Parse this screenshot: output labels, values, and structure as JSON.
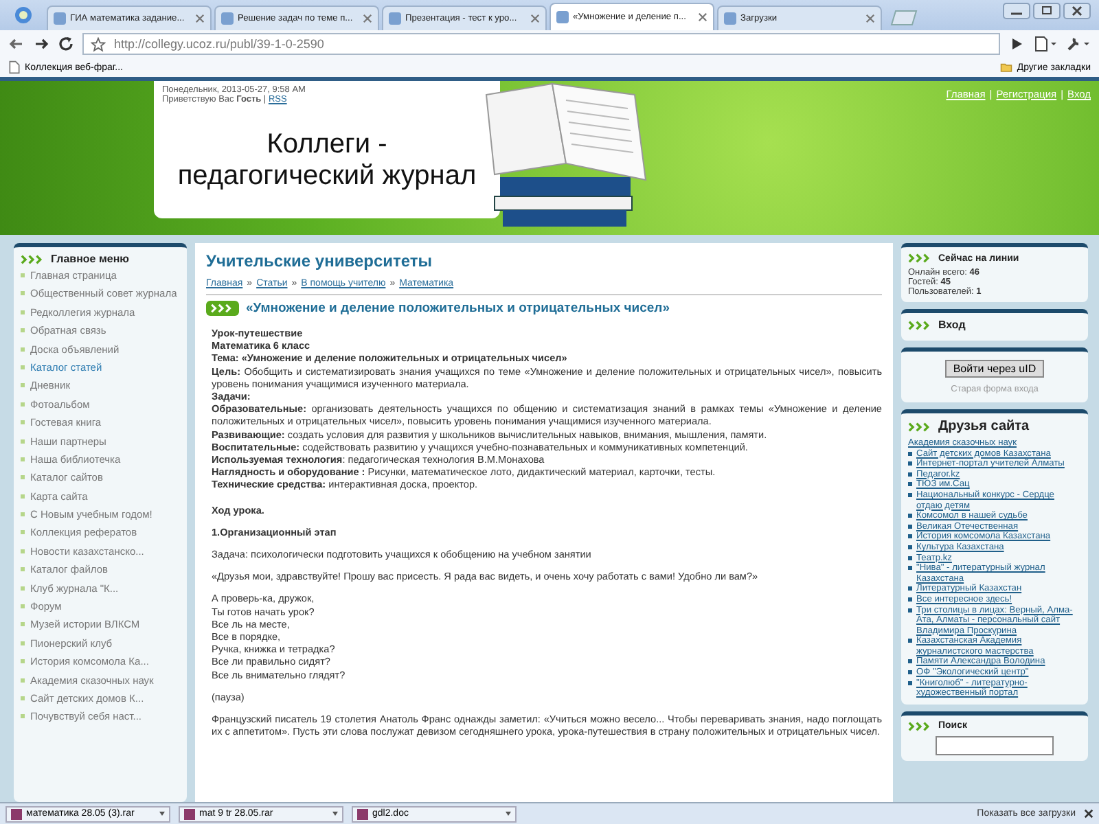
{
  "browser": {
    "tabs": [
      {
        "label": "ГИА математика задание...",
        "selected": false
      },
      {
        "label": "Решение задач по теме п...",
        "selected": false
      },
      {
        "label": "Презентация - тест к уро...",
        "selected": false
      },
      {
        "label": "«Умножение и деление п...",
        "selected": true
      },
      {
        "label": "Загрузки",
        "selected": false
      }
    ],
    "address": "http://collegy.ucoz.ru/publ/39-1-0-2590",
    "bookmarks": [
      "Коллекция веб-фраг..."
    ],
    "other_bookmarks": "Другие закладки"
  },
  "header": {
    "date": "Понедельник, 2013-05-27, 9:58 AM",
    "greeting": "Приветствую Вас **Гость** |",
    "rss": "RSS",
    "title": [
      "Коллеги -",
      "педагогический журнал"
    ],
    "top_links": [
      "Главная",
      "Регистрация",
      "Вход"
    ],
    "link_separator": "|"
  },
  "main_menu": {
    "title": "Главное меню",
    "items": [
      {
        "label": "Главная страница",
        "selected": false
      },
      {
        "label": "Общественный совет журнала",
        "selected": false
      },
      {
        "label": "Редколлегия журнала",
        "selected": false
      },
      {
        "label": "Обратная связь",
        "selected": false
      },
      {
        "label": "Доска объявлений",
        "selected": false
      },
      {
        "label": "Каталог статей",
        "selected": true
      },
      {
        "label": "Дневник",
        "selected": false
      },
      {
        "label": "Фотоальбом",
        "selected": false
      },
      {
        "label": "Гостевая книга",
        "selected": false
      },
      {
        "label": "Наши партнеры",
        "selected": false
      },
      {
        "label": "Наша библиотечка",
        "selected": false
      },
      {
        "label": "Каталог сайтов",
        "selected": false
      },
      {
        "label": "Карта сайта",
        "selected": false
      },
      {
        "label": "С Новым учебным годом!",
        "selected": false
      },
      {
        "label": "Коллекция рефератов",
        "selected": false
      },
      {
        "label": "Новости казахстанско...",
        "selected": false
      },
      {
        "label": "Каталог файлов",
        "selected": false
      },
      {
        "label": "Клуб журнала \"К...",
        "selected": false
      },
      {
        "label": "Форум",
        "selected": false
      },
      {
        "label": "Музей истории ВЛКСМ",
        "selected": false
      },
      {
        "label": "Пионерский клуб",
        "selected": false
      },
      {
        "label": "История комсомола Ка...",
        "selected": false
      },
      {
        "label": "Академия сказочных наук",
        "selected": false
      },
      {
        "label": "Сайт детских домов К...",
        "selected": false
      },
      {
        "label": "Почувствуй себя наст...",
        "selected": false
      }
    ]
  },
  "content": {
    "section_title": "Учительские университеты",
    "breadcrumbs": [
      "Главная",
      "Статьи",
      "В помощь учителю",
      "Математика"
    ],
    "breadcrumb_separator": "»",
    "article_title": "«Умножение и деление положительных и отрицательных чисел»",
    "intro": [
      {
        "kind": "bold",
        "text": "Урок-путешествие"
      },
      {
        "kind": "bold",
        "text": "Математика 6 класс"
      },
      {
        "kind": "bold",
        "text": "Тема: «Умножение и деление положительных и отрицательных чисел»"
      },
      {
        "kind": "text",
        "text": "**Цель:** Обобщить и систематизировать знания учащихся по теме «Умножение и деление положительных и отрицательных чисел», повысить уровень понимания учащимися изученного материала."
      },
      {
        "kind": "bold",
        "text": "Задачи:"
      },
      {
        "kind": "text",
        "text": "**Образовательные:** организовать деятельность учащихся по общению и систематизация знаний в рамках темы «Умножение и деление положительных и отрицательных чисел», повысить уровень понимания учащимися изученного материала."
      },
      {
        "kind": "text",
        "text": "**Развивающие:** создать условия для развития у школьников вычислительных навыков, внимания, мышления, памяти."
      },
      {
        "kind": "text",
        "text": "**Воспитательные:** содействовать развитию у учащихся учебно-познавательных и коммуникативных компетенций."
      },
      {
        "kind": "text",
        "text": "**Используемая технология**: педагогическая технология В.М.Монахова"
      },
      {
        "kind": "text",
        "text": "**Наглядность и оборудование :** Рисунки, математическое лото, дидактический материал, карточки, тесты."
      },
      {
        "kind": "text",
        "text": "**Технические средства:** интерактивная доска, проектор."
      }
    ],
    "body": [
      {
        "kind": "bold",
        "lines": [
          "Ход урока."
        ]
      },
      {
        "kind": "bold",
        "lines": [
          "1.Организационный этап"
        ]
      },
      {
        "kind": "text",
        "lines": [
          "Задача: психологически подготовить учащихся к обобщению на учебном занятии"
        ]
      },
      {
        "kind": "text",
        "lines": [
          "«Друзья мои, здравствуйте! Прошу вас присесть. Я рада вас видеть, и очень хочу работать с вами! Удобно ли вам?»"
        ]
      },
      {
        "kind": "text",
        "lines": [
          "А проверь-ка, дружок,",
          "Ты готов начать урок?",
          "Все ль на месте,",
          "Все в порядке,",
          "Ручка, книжка и тетрадка?",
          "Все ли правильно сидят?",
          "Все ль внимательно глядят?"
        ]
      },
      {
        "kind": "text",
        "lines": [
          "(пауза)"
        ]
      },
      {
        "kind": "text",
        "lines": [
          "Французский писатель 19 столетия Анатоль Франс однажды заметил: «Учиться можно весело... Чтобы переваривать знания, надо поглощать их с аппетитом». Пусть эти слова послужат девизом сегодняшнего урока, урока-путешествия в страну положительных и отрицательных чисел."
        ]
      }
    ]
  },
  "online": {
    "title": "Сейчас на линии",
    "lines": [
      "Онлайн всего: **46**",
      "Гостей: **45**",
      "Пользователей: **1**"
    ]
  },
  "login": {
    "title": "Вход",
    "button": "Войти через uID",
    "old_form": "Старая форма входа"
  },
  "friends": {
    "title": "Друзья сайта",
    "links": [
      {
        "kind": "plain",
        "label": "Академия сказочных наук"
      },
      {
        "kind": "bullet",
        "label": "Сайт детских домов Казахстана"
      },
      {
        "kind": "bullet",
        "label": "Интернет-портал учителей Алматы"
      },
      {
        "kind": "bullet",
        "label": "Педагог.kz"
      },
      {
        "kind": "bullet",
        "label": "ТЮЗ им.Сац"
      },
      {
        "kind": "bullet",
        "label": "Национальный конкурс - Сердце отдаю детям"
      },
      {
        "kind": "bullet",
        "label": "Комсомол в нашей судьбе"
      },
      {
        "kind": "bullet",
        "label": "Великая Отечественная"
      },
      {
        "kind": "bullet",
        "label": "История комсомола Казахстана"
      },
      {
        "kind": "bullet",
        "label": "Культура Казахстана"
      },
      {
        "kind": "bullet",
        "label": "Театр.kz"
      },
      {
        "kind": "bullet",
        "label": "\"Нива\" - литературный журнал Казахстана"
      },
      {
        "kind": "bullet",
        "label": "Литературный Казахстан"
      },
      {
        "kind": "bullet",
        "label": "Все интересное здесь!"
      },
      {
        "kind": "bullet",
        "label": "Три столицы в лицах: Верный, Алма-Ата, Алматы - персональный сайт Владимира Проскурина"
      },
      {
        "kind": "bullet",
        "label": "Казахстанская Академия журналистского мастерства"
      },
      {
        "kind": "bullet",
        "label": "Памяти Александра Володина"
      },
      {
        "kind": "bullet",
        "label": "ОФ \"Экологический центр\""
      },
      {
        "kind": "bullet",
        "label": "\"Книголюб\" - литературно-художественный портал"
      }
    ]
  },
  "search": {
    "title": "Поиск"
  },
  "downloads": {
    "items": [
      "математика 28.05 (3).rar",
      "mat 9 tr 28.05.rar",
      "gdl2.doc"
    ],
    "show_all": "Показать все загрузки"
  }
}
